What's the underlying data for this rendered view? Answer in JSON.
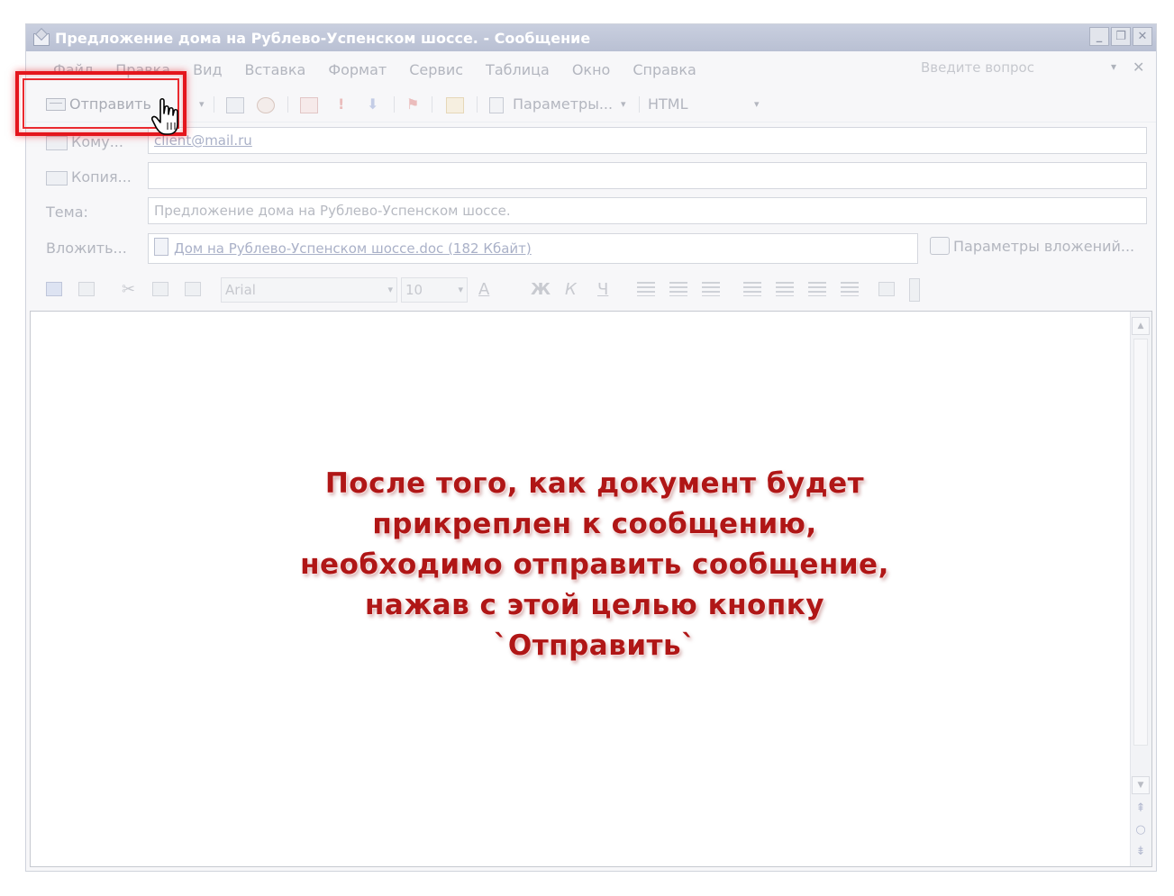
{
  "window": {
    "title": "Предложение дома на Рублево-Успенском шоссе. - Сообщение",
    "controls": [
      "_",
      "❐",
      "✕"
    ]
  },
  "menubar": {
    "items": [
      "Файл",
      "Правка",
      "Вид",
      "Вставка",
      "Формат",
      "Сервис",
      "Таблица",
      "Окно",
      "Справка"
    ],
    "ask_placeholder": "Введите вопрос",
    "ask_arrow": "▾",
    "close": "✕"
  },
  "toolbar": {
    "send_label": "Отправить",
    "options_label": "Параметры...",
    "format_value": "HTML",
    "dropdown_arrow": "▾"
  },
  "header": {
    "to_label": "Кому...",
    "to_value": "client@mail.ru",
    "cc_label": "Копия...",
    "cc_value": "",
    "subject_label": "Тема:",
    "subject_value": "Предложение дома на Рублево-Успенском шоссе.",
    "attach_label": "Вложить...",
    "attach_value": "Дом на Рублево-Успенском шоссе.doc (182 Кбайт)",
    "attach_options_label": "Параметры вложений..."
  },
  "format_toolbar": {
    "font": "Arial",
    "size": "10",
    "bold": "Ж",
    "italic": "К",
    "underline": "Ч",
    "font_color": "A"
  },
  "callout": {
    "lines": [
      "После того, как документ будет",
      "прикреплен к сообщению,",
      "необходимо отправить сообщение,",
      "нажав с этой целью кнопку",
      "`Отправить`"
    ]
  },
  "colors": {
    "highlight": "#e4161d",
    "callout_text": "#b01616",
    "titlebar": "#c0c7d9"
  }
}
